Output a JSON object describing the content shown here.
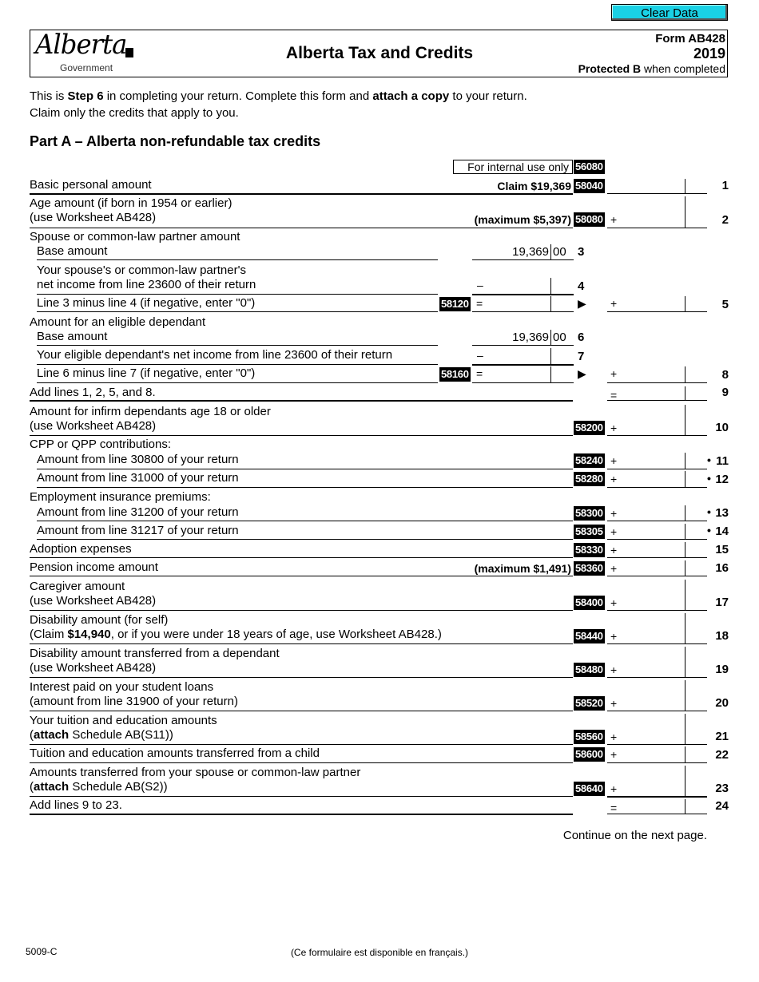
{
  "toolbar": {
    "clear_data_label": "Clear Data",
    "clear_data_color": "#1ad1e5"
  },
  "header": {
    "logo_text": "Alberta",
    "logo_subtext": "Government",
    "title": "Alberta Tax and Credits",
    "form_id": "Form AB428",
    "year": "2019",
    "protected_bold": "Protected B",
    "protected_rest": " when completed"
  },
  "intro": {
    "line1_a": "This is ",
    "line1_b": "Step 6",
    "line1_c": " in completing your return. Complete this form and ",
    "line1_d": "attach a copy",
    "line1_e": " to your return.",
    "line2": "Claim only the credits that apply to you."
  },
  "part_a": {
    "title": "Part A – Alberta non-refundable tax credits",
    "internal_use_label": "For internal use only",
    "internal_use_code": "56080",
    "lines": [
      {
        "num": "1",
        "label": "Basic personal amount",
        "note": "Claim $19,369",
        "code": "58040",
        "op": ""
      },
      {
        "num": "2",
        "label1": "Age amount (if born in 1954 or earlier)",
        "label2": "(use Worksheet AB428)",
        "note": "(maximum $5,397)",
        "code": "58080",
        "op": "+"
      },
      {
        "header": "Spouse or common-law partner amount"
      },
      {
        "num": "3",
        "label": "Base amount",
        "value": "19,369",
        "cents": "00"
      },
      {
        "num": "4",
        "label1": "Your spouse's or common-law partner's",
        "label2": "net income from line 23600 of their return",
        "op": "–"
      },
      {
        "num": "5",
        "label": "Line 3 minus line 4 (if negative, enter \"0\")",
        "code": "58120",
        "op": "=",
        "arrow": "▶",
        "op2": "+"
      },
      {
        "header": "Amount for an eligible dependant"
      },
      {
        "num": "6",
        "label": "Base amount",
        "value": "19,369",
        "cents": "00"
      },
      {
        "num": "7",
        "label": "Your eligible dependant's net income from line 23600 of their return",
        "op": "–"
      },
      {
        "num": "8",
        "label": "Line 6 minus line 7 (if negative, enter \"0\")",
        "code": "58160",
        "op": "=",
        "arrow": "▶",
        "op2": "+"
      },
      {
        "num": "9",
        "label": "Add lines 1, 2, 5, and 8.",
        "op": "="
      },
      {
        "num": "10",
        "label1": "Amount for infirm dependants age 18 or older",
        "label2": "(use Worksheet AB428)",
        "code": "58200",
        "op": "+"
      },
      {
        "header": "CPP or QPP contributions:"
      },
      {
        "num": "11",
        "label": "Amount from line 30800 of your return",
        "code": "58240",
        "op": "+",
        "bullet": "•"
      },
      {
        "num": "12",
        "label": "Amount from line 31000 of your return",
        "code": "58280",
        "op": "+",
        "bullet": "•"
      },
      {
        "header": "Employment insurance premiums:"
      },
      {
        "num": "13",
        "label": "Amount from line 31200 of your return",
        "code": "58300",
        "op": "+",
        "bullet": "•"
      },
      {
        "num": "14",
        "label": "Amount from line 31217 of your return",
        "code": "58305",
        "op": "+",
        "bullet": "•"
      },
      {
        "num": "15",
        "label": "Adoption expenses",
        "code": "58330",
        "op": "+"
      },
      {
        "num": "16",
        "label": "Pension income amount",
        "note": "(maximum $1,491)",
        "code": "58360",
        "op": "+"
      },
      {
        "num": "17",
        "label1": "Caregiver amount",
        "label2": "(use Worksheet AB428)",
        "code": "58400",
        "op": "+"
      },
      {
        "num": "18",
        "label1": "Disability amount (for self)",
        "label2_a": "(Claim ",
        "label2_b": "$14,940",
        "label2_c": ", or if you were under 18 years of age, use Worksheet AB428.)",
        "code": "58440",
        "op": "+"
      },
      {
        "num": "19",
        "label1": "Disability amount transferred from a dependant",
        "label2": "(use Worksheet AB428)",
        "code": "58480",
        "op": "+"
      },
      {
        "num": "20",
        "label1": "Interest paid on your student loans",
        "label2": "(amount from line 31900 of your return)",
        "code": "58520",
        "op": "+"
      },
      {
        "num": "21",
        "label1": "Your tuition and education amounts",
        "label2_a": "(",
        "label2_b": "attach",
        "label2_c": " Schedule AB(S11))",
        "code": "58560",
        "op": "+"
      },
      {
        "num": "22",
        "label": "Tuition and education amounts transferred from a child",
        "code": "58600",
        "op": "+"
      },
      {
        "num": "23",
        "label1": "Amounts transferred from your spouse or common-law partner",
        "label2_a": "(",
        "label2_b": "attach",
        "label2_c": " Schedule AB(S2))",
        "code": "58640",
        "op": "+"
      },
      {
        "num": "24",
        "label": "Add lines 9 to 23.",
        "op": "="
      }
    ]
  },
  "footer": {
    "continue": "Continue on the next page.",
    "form_code": "5009-C",
    "french_note": "(Ce formulaire est disponible en français.)"
  }
}
